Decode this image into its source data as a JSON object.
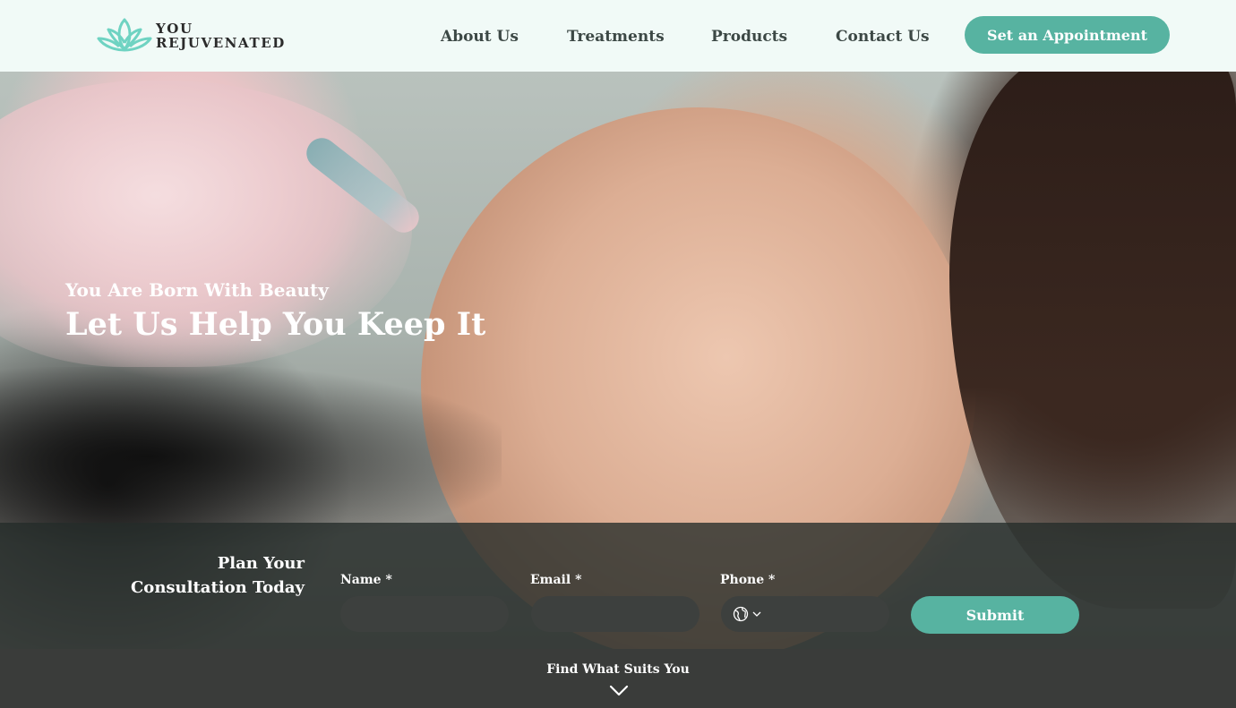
{
  "brand": {
    "line1": "YOU",
    "line2": "REJUVENATED",
    "logo_icon": "lotus-icon",
    "accent_color": "#57b3a1",
    "logo_color": "#6fd3c2"
  },
  "nav": {
    "items": [
      {
        "label": "About Us"
      },
      {
        "label": "Treatments"
      },
      {
        "label": "Products"
      },
      {
        "label": "Contact Us"
      }
    ],
    "cta_label": "Set an Appointment"
  },
  "hero": {
    "subtitle": "You Are Born With Beauty",
    "title": "Let Us Help You Keep It"
  },
  "consultation": {
    "title_line1": "Plan Your",
    "title_line2": "Consultation Today",
    "fields": {
      "name_label": "Name *",
      "name_value": "",
      "email_label": "Email *",
      "email_value": "",
      "phone_label": "Phone *",
      "phone_value": "",
      "phone_country_icon": "globe-icon"
    },
    "submit_label": "Submit"
  },
  "footer_bar": {
    "label": "Find What Suits You",
    "icon": "chevron-down-icon"
  }
}
